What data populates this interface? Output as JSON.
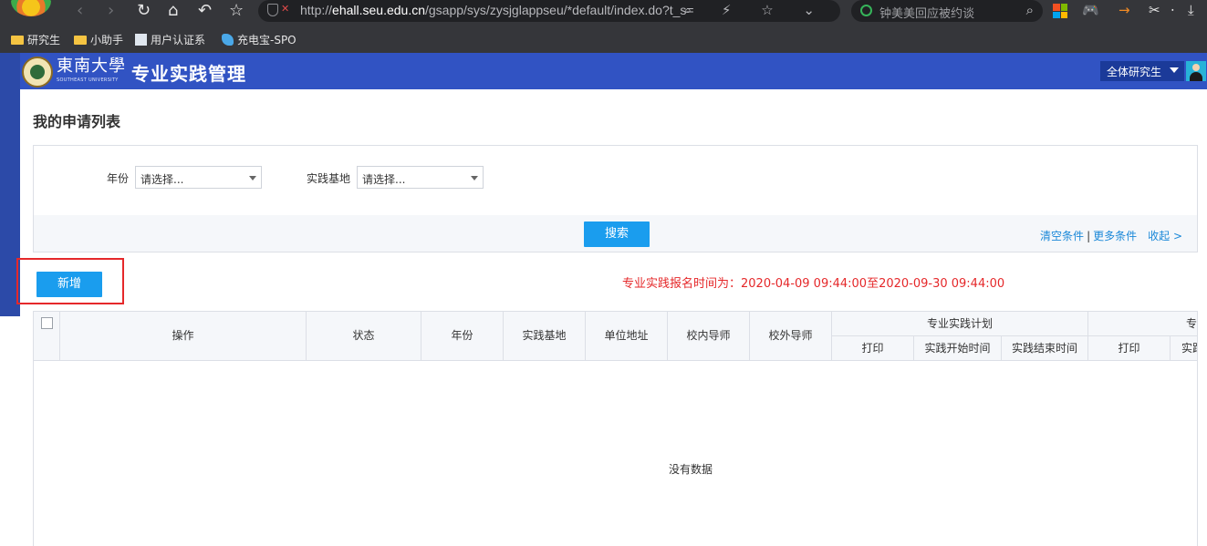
{
  "browser": {
    "url_prefix": "http://",
    "url_host": "ehall.seu.edu.cn",
    "url_path": "/gsapp/sys/zysjglappseu/*default/index.do?t_s=",
    "search_placeholder": "钟美美回应被约谈",
    "nav": {
      "back": "‹",
      "forward": "›",
      "reload": "↻",
      "home": "⌂",
      "undo": "↶",
      "star": "☆"
    },
    "url_actions": "⌕ ⚡ ☆ ⌄",
    "bookmarks": [
      {
        "label": "研究生",
        "icon": "folder-icon"
      },
      {
        "label": "小助手",
        "icon": "folder-icon"
      },
      {
        "label": "用户认证系",
        "icon": "page-icon"
      },
      {
        "label": "充电宝-SPO",
        "icon": "site-icon"
      }
    ],
    "extensions": {
      "game": "🎮",
      "arrow": "→",
      "scissors": "✂",
      "more": "⋅",
      "download": "⤓"
    }
  },
  "header": {
    "university_name": "東南大學",
    "university_sub": "SOUTHEAST UNIVERSITY",
    "app_title": "专业实践管理",
    "role_select": "全体研究生"
  },
  "page": {
    "title": "我的申请列表"
  },
  "filters": {
    "year_label": "年份",
    "year_placeholder": "请选择...",
    "base_label": "实践基地",
    "base_placeholder": "请选择...",
    "search_button": "搜索",
    "clear_link": "清空条件",
    "separator": "|",
    "more_link": "更多条件",
    "collapse_link": "收起 >"
  },
  "actions": {
    "add_button": "新增",
    "notice": "专业实践报名时间为：2020-04-09 09:44:00至2020-09-30 09:44:00"
  },
  "table": {
    "columns": [
      "操作",
      "状态",
      "年份",
      "实践基地",
      "单位地址",
      "校内导师",
      "校外导师"
    ],
    "group_1": {
      "label": "专业实践计划",
      "sub": [
        "打印",
        "实践开始时间",
        "实践结束时间"
      ]
    },
    "group_2": {
      "label": "专",
      "sub": [
        "打印",
        "实践"
      ]
    },
    "empty_text": "没有数据"
  },
  "colors": {
    "header_blue": "#3153c3",
    "primary_button": "#1a9dee",
    "highlight_red": "#e5282a",
    "link_blue": "#1a88d8"
  }
}
